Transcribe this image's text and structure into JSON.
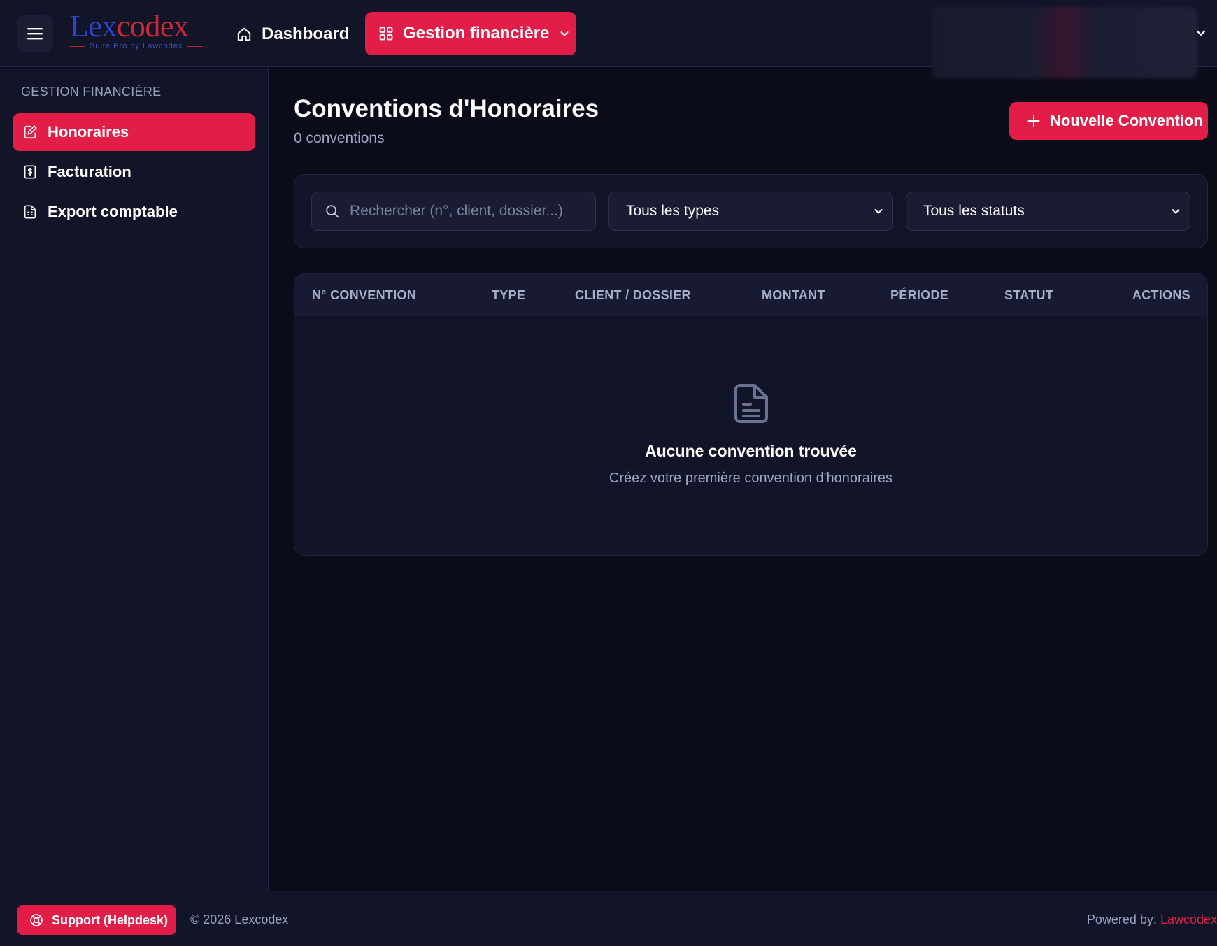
{
  "header": {
    "logo": {
      "name_part1": "Lex",
      "name_part2": "codex",
      "tagline": "Suite Pro by Lawcodex"
    },
    "nav": {
      "dashboard_label": "Dashboard",
      "gestion_label": "Gestion financière"
    }
  },
  "sidebar": {
    "section_title": "GESTION FINANCIÈRE",
    "items": [
      {
        "label": "Honoraires",
        "icon": "edit-document-icon",
        "active": true
      },
      {
        "label": "Facturation",
        "icon": "invoice-dollar-icon",
        "active": false
      },
      {
        "label": "Export comptable",
        "icon": "spreadsheet-file-icon",
        "active": false
      }
    ]
  },
  "main": {
    "title": "Conventions d'Honoraires",
    "subtitle": "0 conventions",
    "new_button_label": "Nouvelle Convention",
    "filters": {
      "search_placeholder": "Rechercher (n°, client, dossier...)",
      "type_select_value": "Tous les types",
      "status_select_value": "Tous les statuts"
    },
    "table": {
      "columns": [
        "N° CONVENTION",
        "TYPE",
        "CLIENT / DOSSIER",
        "MONTANT",
        "PÉRIODE",
        "STATUT",
        "ACTIONS"
      ],
      "rows": [],
      "empty_title": "Aucune convention trouvée",
      "empty_subtitle": "Créez votre première convention d'honoraires"
    }
  },
  "footer": {
    "support_label": "Support (Helpdesk)",
    "copyright": "© 2026 Lexcodex",
    "powered_prefix": "Powered by: ",
    "powered_brand": "Lawcodex"
  },
  "colors": {
    "accent": "#e11d48",
    "background": "#0b0c1a",
    "panel": "#121428"
  }
}
